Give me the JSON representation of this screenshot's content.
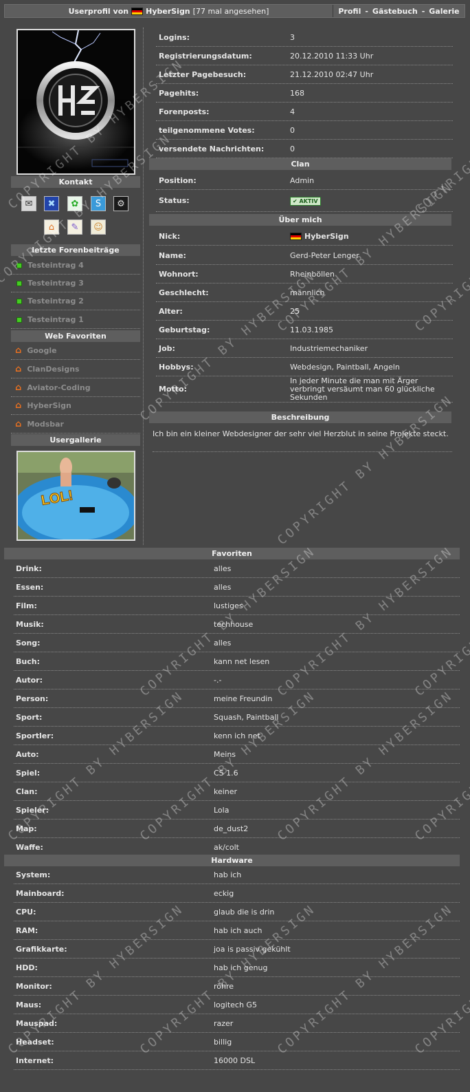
{
  "header": {
    "prefix": "Userprofil von",
    "nick": "HyberSign",
    "views": "[77 mal angesehen]",
    "nav": [
      "Profil",
      "-",
      "Gästebuch",
      "-",
      "Galerie"
    ]
  },
  "left": {
    "contact_title": "Kontakt",
    "forum_title": "letzte Forenbeiträge",
    "forum_posts": [
      "Testeintrag 4",
      "Testeintrag 3",
      "Testeintrag 2",
      "Testeintrag 1"
    ],
    "fav_title": "Web Favoriten",
    "fav_links": [
      "Google",
      "ClanDesigns",
      "Aviator-Coding",
      "HyberSign",
      "Modsbar"
    ],
    "gallery_title": "Usergallerie",
    "gallery_text": "LOL!"
  },
  "stats": [
    {
      "label": "Logins:",
      "value": "3"
    },
    {
      "label": "Registrierungsdatum:",
      "value": "20.12.2010 11:33 Uhr"
    },
    {
      "label": "Letzter Pagebesuch:",
      "value": "21.12.2010 02:47 Uhr"
    },
    {
      "label": "Pagehits:",
      "value": "168"
    },
    {
      "label": "Forenposts:",
      "value": "4"
    },
    {
      "label": "teilgenommene Votes:",
      "value": "0"
    },
    {
      "label": "versendete Nachrichten:",
      "value": "0"
    }
  ],
  "clan": {
    "title": "Clan",
    "position_label": "Position:",
    "position_value": "Admin",
    "status_label": "Status:",
    "status_badge": "AKTIV"
  },
  "about": {
    "title": "Über mich",
    "nick_label": "Nick:",
    "nick_value": "HyberSign",
    "rows": [
      {
        "label": "Name:",
        "value": "Gerd-Peter Lenger"
      },
      {
        "label": "Wohnort:",
        "value": "Rheinböllen"
      },
      {
        "label": "Geschlecht:",
        "value": "männlich"
      },
      {
        "label": "Alter:",
        "value": "25"
      },
      {
        "label": "Geburtstag:",
        "value": "11.03.1985"
      },
      {
        "label": "Job:",
        "value": "Industriemechaniker"
      },
      {
        "label": "Hobbys:",
        "value": "Webdesign, Paintball, Angeln"
      },
      {
        "label": "Motto:",
        "value": "In jeder Minute die man mit Ärger verbringt versäumt man 60 glückliche Sekunden"
      }
    ]
  },
  "description": {
    "title": "Beschreibung",
    "text": "Ich bin ein kleiner Webdesigner der sehr viel Herzblut in seine Projekte steckt."
  },
  "favorites": {
    "title": "Favoriten",
    "rows": [
      {
        "label": "Drink:",
        "value": "alles"
      },
      {
        "label": "Essen:",
        "value": "alles"
      },
      {
        "label": "Film:",
        "value": "lustiges"
      },
      {
        "label": "Musik:",
        "value": "techhouse"
      },
      {
        "label": "Song:",
        "value": "alles"
      },
      {
        "label": "Buch:",
        "value": "kann net lesen"
      },
      {
        "label": "Autor:",
        "value": "-.-"
      },
      {
        "label": "Person:",
        "value": "meine Freundin"
      },
      {
        "label": "Sport:",
        "value": "Squash, Paintball"
      },
      {
        "label": "Sportler:",
        "value": "kenn ich net"
      },
      {
        "label": "Auto:",
        "value": "Meins"
      },
      {
        "label": "Spiel:",
        "value": "CS 1.6"
      },
      {
        "label": "Clan:",
        "value": "keiner"
      },
      {
        "label": "Spieler:",
        "value": "Lola"
      },
      {
        "label": "Map:",
        "value": "de_dust2"
      },
      {
        "label": "Waffe:",
        "value": "ak/colt"
      }
    ]
  },
  "hardware": {
    "title": "Hardware",
    "rows": [
      {
        "label": "System:",
        "value": "hab ich"
      },
      {
        "label": "Mainboard:",
        "value": "eckig"
      },
      {
        "label": "CPU:",
        "value": "glaub die is drin"
      },
      {
        "label": "RAM:",
        "value": "hab ich auch"
      },
      {
        "label": "Grafikkarte:",
        "value": "joa is passiv gekühlt"
      },
      {
        "label": "HDD:",
        "value": "hab ich genug"
      },
      {
        "label": "Monitor:",
        "value": "röhre"
      },
      {
        "label": "Maus:",
        "value": "logitech G5"
      },
      {
        "label": "Mauspad:",
        "value": "razer"
      },
      {
        "label": "Headset:",
        "value": "billig"
      },
      {
        "label": "Internet:",
        "value": "16000 DSL"
      }
    ]
  },
  "watermark": "COPYRIGHT BY HYBERSIGN"
}
